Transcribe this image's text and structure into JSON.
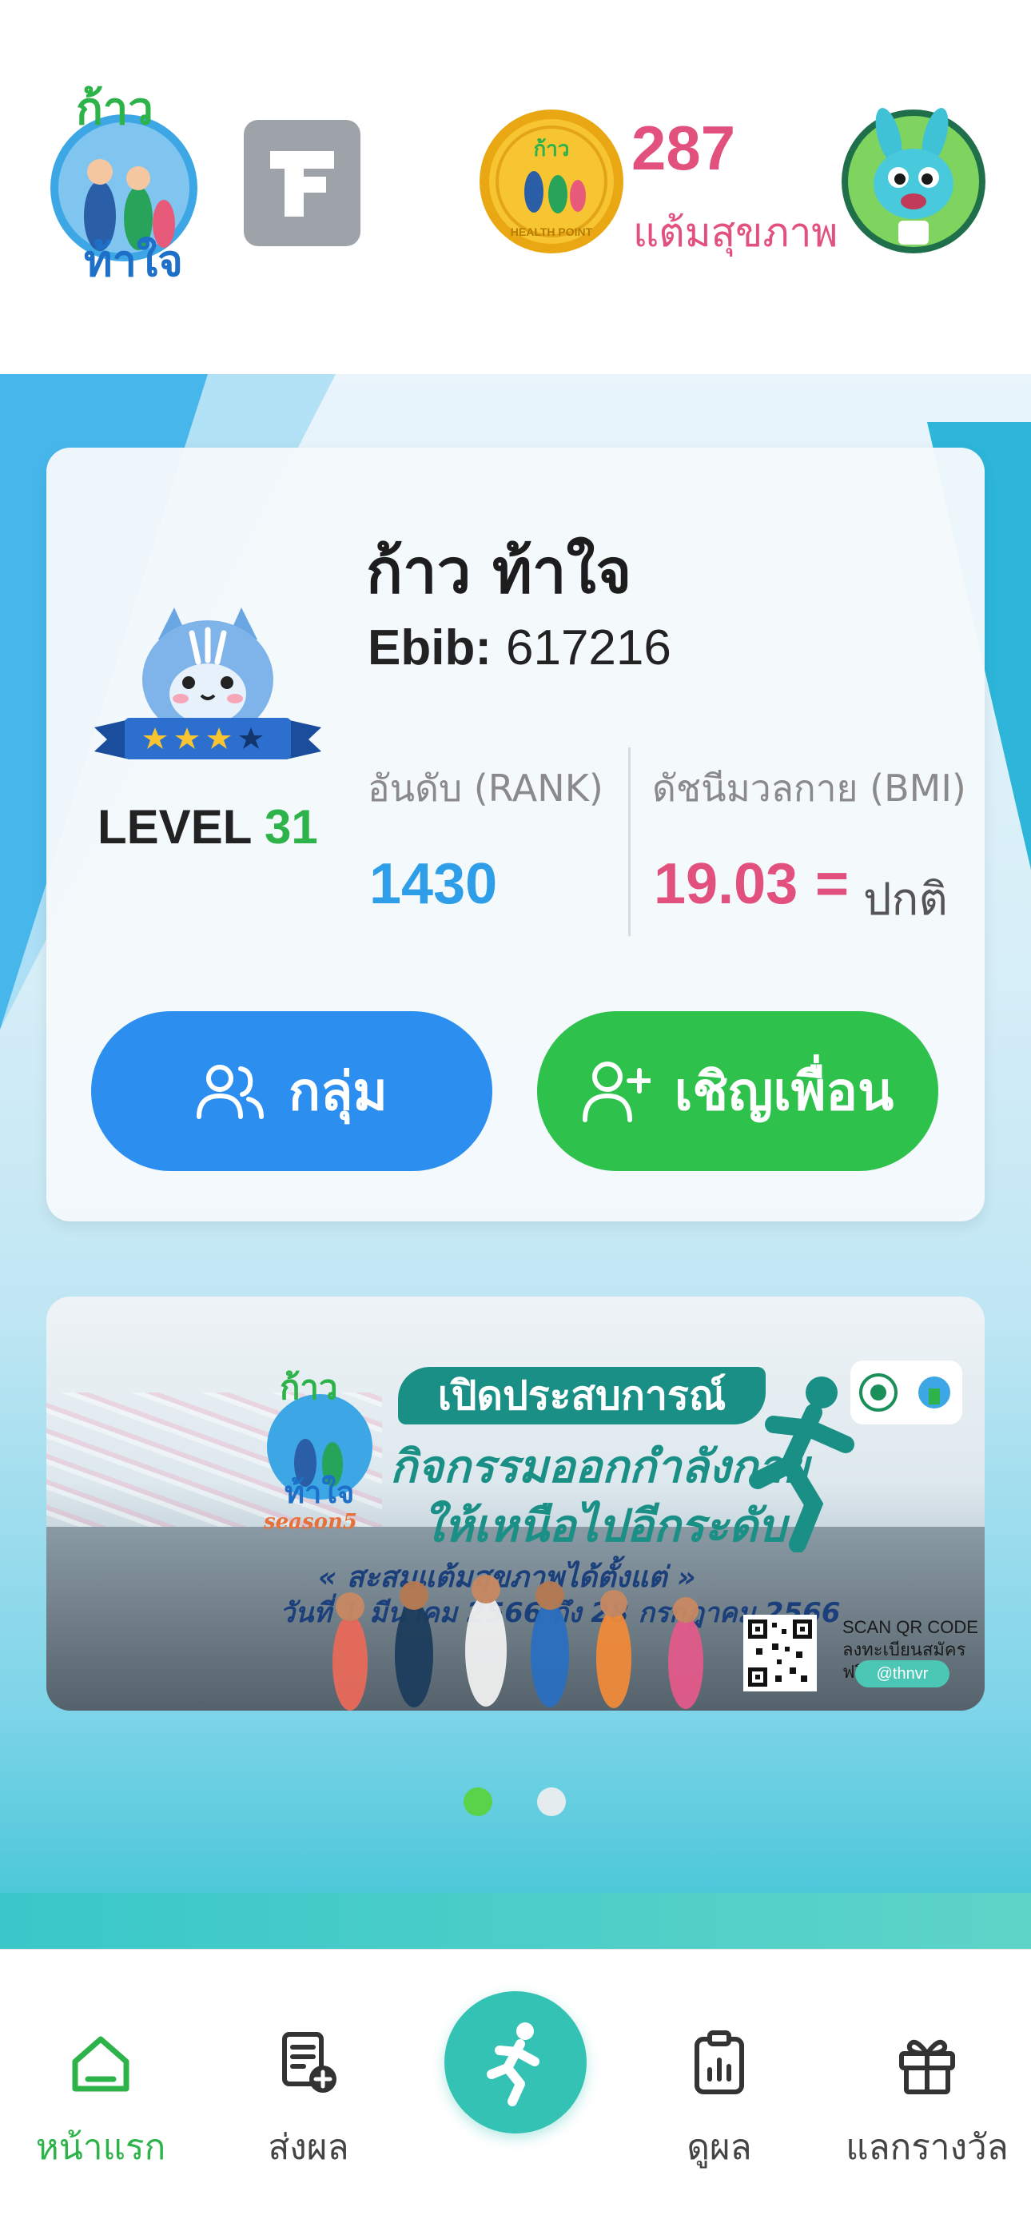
{
  "header": {
    "logo_text_top": "ก้าว",
    "logo_text_bottom": "ท้าใจ",
    "points_value": "287",
    "points_label": "แต้มสุขภาพ",
    "coin_text": "HEALTH POINT"
  },
  "profile": {
    "name": "ก้าว ท้าใจ",
    "ebib_label": "Ebib:",
    "ebib_value": "617216",
    "level_label": "LEVEL",
    "level_value": "31",
    "stars_filled": 3,
    "stars_total": 4,
    "rank_label": "อันดับ (RANK)",
    "rank_value": "1430",
    "bmi_label": "ดัชนีมวลกาย (BMI)",
    "bmi_value": "19.03",
    "bmi_eq": "=",
    "bmi_status": "ปกติ"
  },
  "actions": {
    "group_label": "กลุ่ม",
    "invite_label": "เชิญเพื่อน"
  },
  "banner": {
    "logo_top": "ก้าว",
    "logo_bottom": "ท้าใจ",
    "season": "season5",
    "headline": "เปิดประสบการณ์",
    "line2": "กิจกรรมออกกำลังกาย",
    "line3": "ให้เหนือไปอีกระดับ",
    "sub": "« สะสมแต้มสุขภาพได้ตั้งแต่ »",
    "date": "วันที่ 1 มีนาคม 2566 ถึง 28 กรกฎาคม 2566",
    "scan_line1": "SCAN QR CODE",
    "scan_line2": "ลงทะเบียนสมัครฟรี",
    "handle": "@thnvr"
  },
  "carousel": {
    "active_index": 0,
    "count": 2
  },
  "nav": {
    "home": "หน้าแรก",
    "submit": "ส่งผล",
    "results": "ดูผล",
    "rewards": "แลกรางวัล"
  },
  "colors": {
    "accent_pink": "#e2507d",
    "accent_blue": "#2c8ff0",
    "accent_green": "#2ec24d",
    "fab_teal": "#33c2b4"
  }
}
